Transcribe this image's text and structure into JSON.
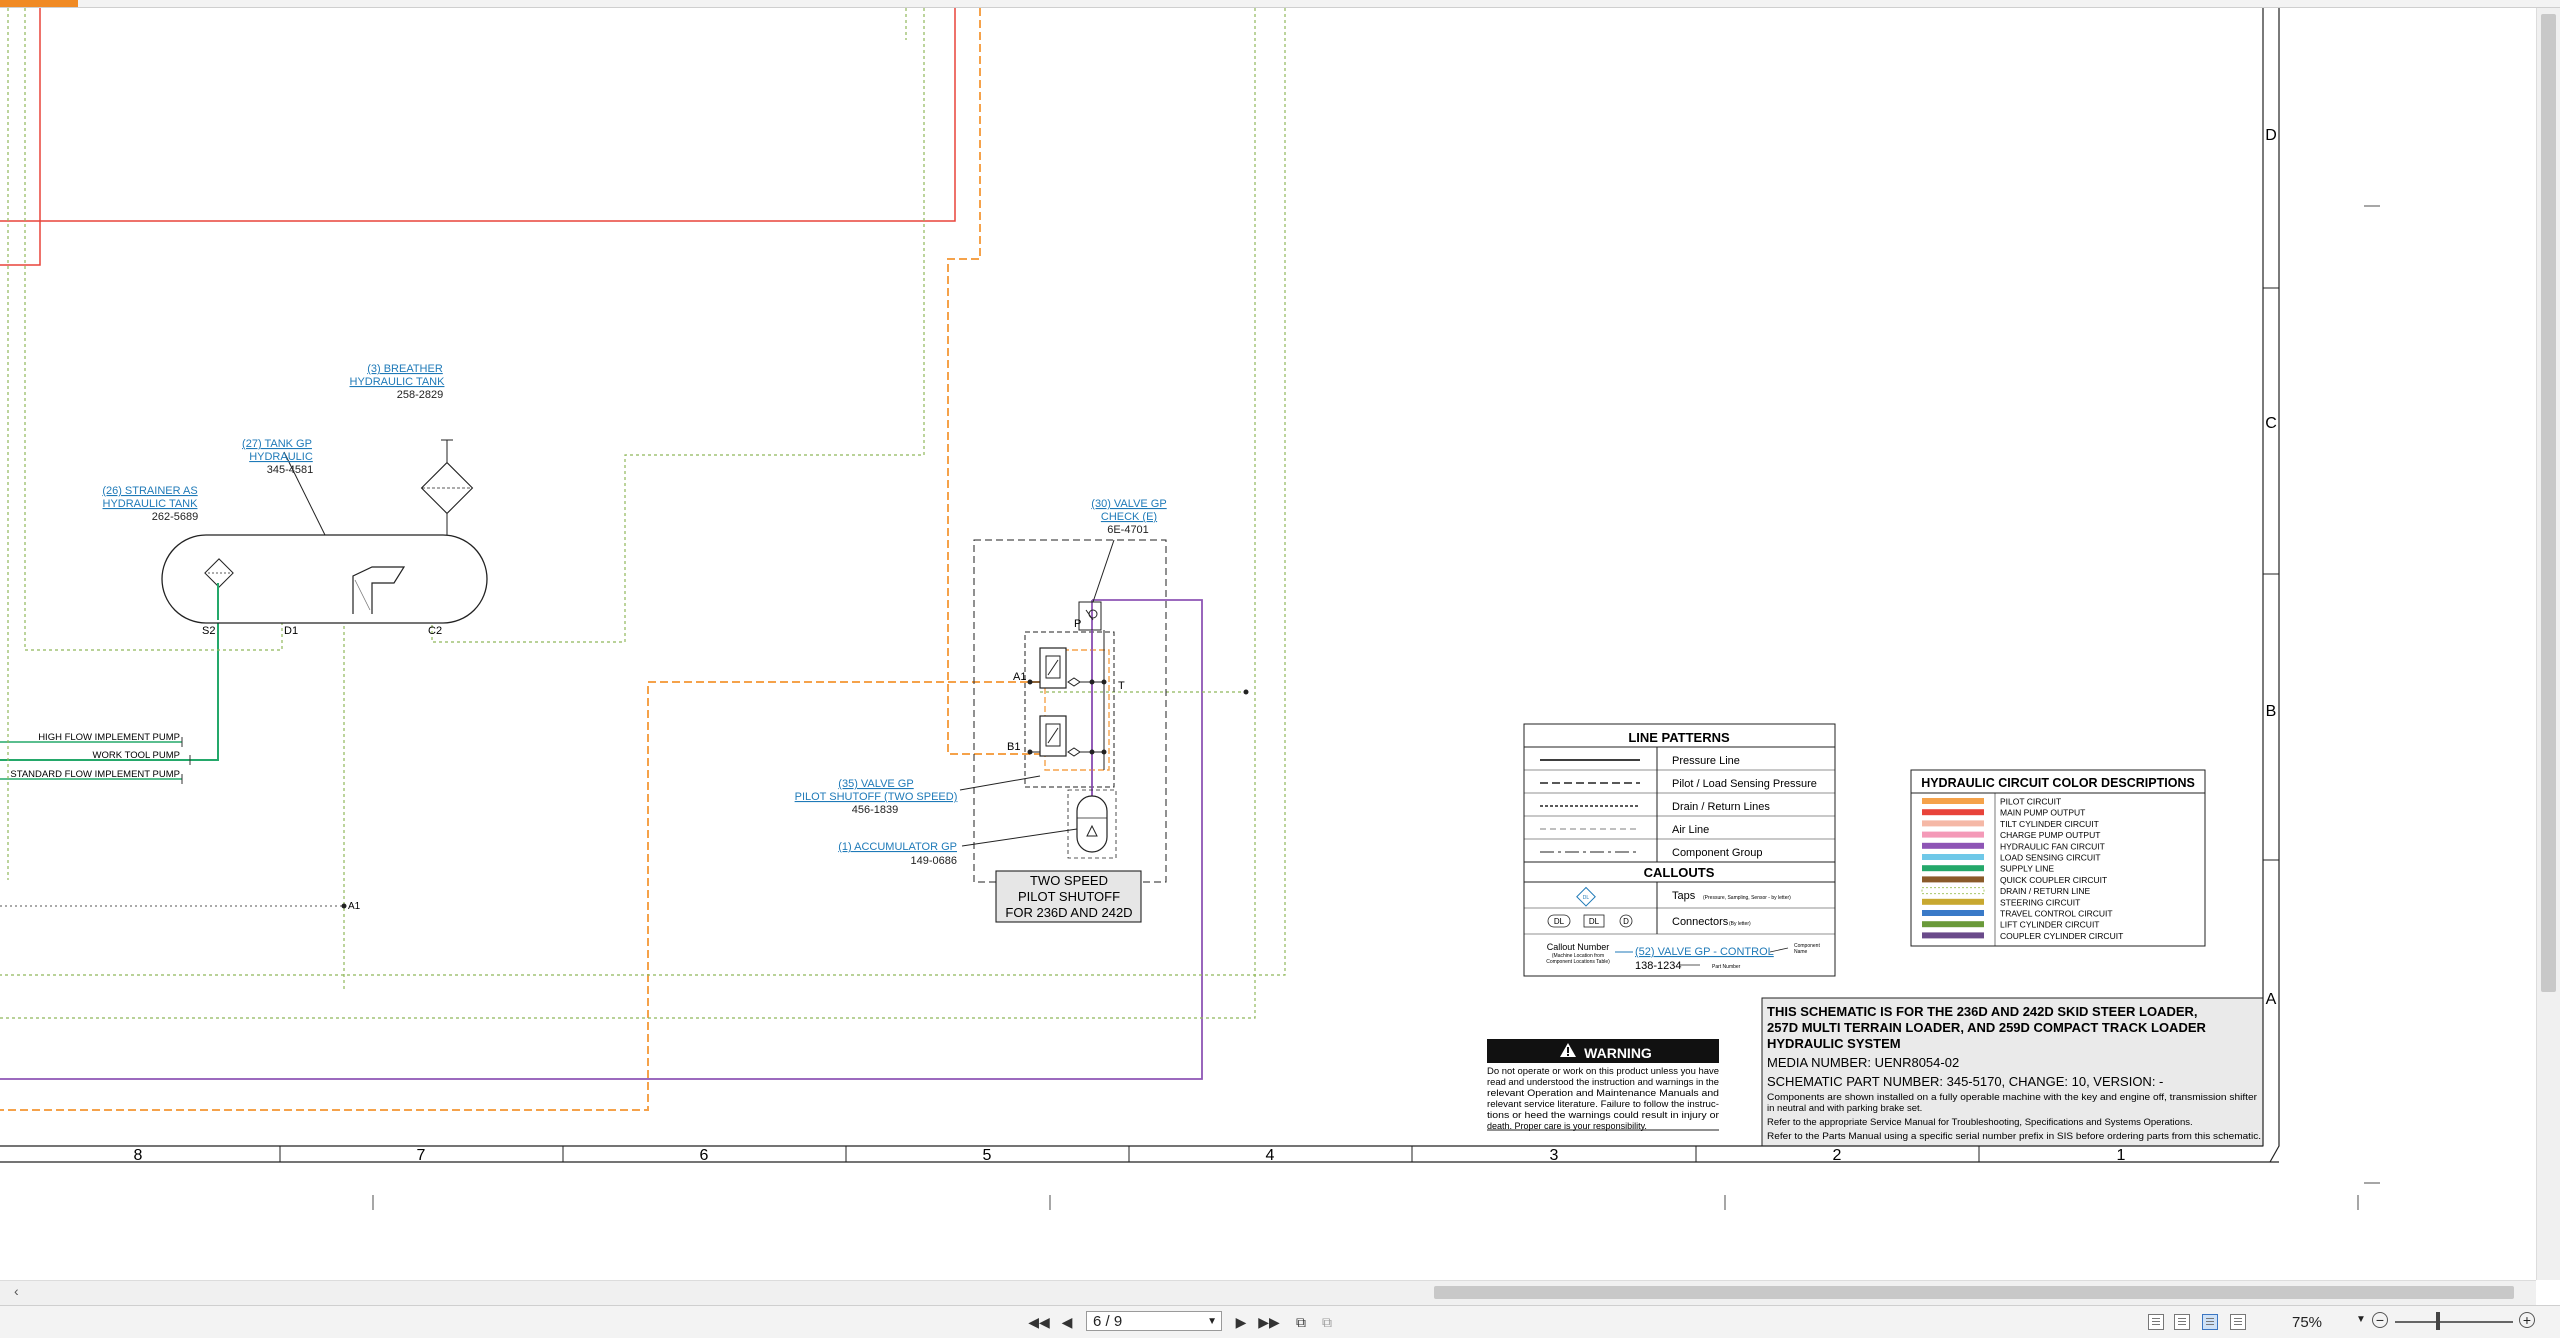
{
  "schematic": {
    "border_letters": [
      "D",
      "C",
      "B",
      "A"
    ],
    "column_numbers": [
      "8",
      "7",
      "6",
      "5",
      "4",
      "3",
      "2",
      "1"
    ],
    "components": {
      "breather": {
        "callout": [
          "(3) BREATHER",
          "HYDRAULIC TANK"
        ],
        "part": "258-2829"
      },
      "tank": {
        "callout": [
          "(27) TANK GP",
          "HYDRAULIC"
        ],
        "part": "345-4581"
      },
      "strainer": {
        "callout": [
          "(26) STRAINER AS",
          "HYDRAULIC TANK"
        ],
        "part": "262-5689"
      },
      "check_valve": {
        "callout": [
          "(30) VALVE GP",
          "CHECK (E)"
        ],
        "part": "6E-4701"
      },
      "pilot_valve": {
        "callout": [
          "(35) VALVE GP",
          "PILOT SHUTOFF (TWO SPEED)"
        ],
        "part": "456-1839"
      },
      "accumulator": {
        "callout": "(1) ACCUMULATOR GP",
        "part": "149-0686"
      }
    },
    "port_labels": {
      "s2": "S2",
      "d1": "D1",
      "c2": "C2",
      "a1": "A1",
      "b1": "B1",
      "p": "P",
      "t": "T",
      "a1_conn": "A1"
    },
    "pump_lines": [
      "HIGH FLOW IMPLEMENT PUMP",
      "WORK TOOL PUMP",
      "STANDARD FLOW IMPLEMENT PUMP"
    ],
    "two_speed_box": [
      "TWO SPEED",
      "PILOT SHUTOFF",
      "FOR 236D AND 242D"
    ],
    "line_patterns": {
      "title": "LINE PATTERNS",
      "items": [
        "Pressure Line",
        "Pilot / Load Sensing Pressure",
        "Drain / Return Lines",
        "Air Line",
        "Component Group"
      ],
      "callouts_title": "CALLOUTS",
      "taps": "Taps",
      "taps_note": "(Pressure, Sampling, Sensor - by letter)",
      "connectors": "Connectors",
      "connectors_note": "(By letter)",
      "conn_dl": "DL",
      "conn_d": "D",
      "tap_symbol": "DL",
      "callout_number": "Callout Number",
      "callout_note": [
        "(Machine Location from",
        "Component Locations Table)"
      ],
      "example_callout": "(52) VALVE GP - CONTROL",
      "example_part": "138-1234",
      "component_name": [
        "Component",
        "Name"
      ],
      "part_number": "Part Number"
    },
    "color_descriptions": {
      "title": "HYDRAULIC CIRCUIT COLOR DESCRIPTIONS",
      "items": [
        {
          "label": "PILOT CIRCUIT",
          "color": "#f5a24a"
        },
        {
          "label": "MAIN PUMP OUTPUT",
          "color": "#e8433a"
        },
        {
          "label": "TILT CYLINDER CIRCUIT",
          "color": "#f5b8a6"
        },
        {
          "label": "CHARGE PUMP OUTPUT",
          "color": "#f49ab8"
        },
        {
          "label": "HYDRAULIC FAN CIRCUIT",
          "color": "#8e55b5"
        },
        {
          "label": "LOAD SENSING CIRCUIT",
          "color": "#6fc8e8"
        },
        {
          "label": "SUPPLY LINE",
          "color": "#24a86a"
        },
        {
          "label": "QUICK COUPLER CIRCUIT",
          "color": "#8a5a2a"
        },
        {
          "label": "DRAIN / RETURN LINE",
          "color": "#a8c86a"
        },
        {
          "label": "STEERING CIRCUIT",
          "color": "#c8a830"
        },
        {
          "label": "TRAVEL CONTROL CIRCUIT",
          "color": "#3a7ac8"
        },
        {
          "label": "LIFT CYLINDER CIRCUIT",
          "color": "#6a9a3a"
        },
        {
          "label": "COUPLER CYLINDER CIRCUIT",
          "color": "#6a4a8a"
        }
      ]
    },
    "warning": {
      "title": "WARNING",
      "text": [
        "Do not operate or work on this product unless you have",
        "read and understood the instruction and warnings in the",
        "relevant Operation and Maintenance Manuals and",
        "relevant service literature. Failure to follow the instruc-",
        "tions or heed the warnings could result in injury or",
        "death. Proper care is your responsibility."
      ]
    },
    "title_block": {
      "heading": [
        "THIS SCHEMATIC IS FOR THE 236D AND 242D SKID STEER LOADER,",
        "257D MULTI TERRAIN LOADER, AND 259D COMPACT TRACK LOADER",
        "HYDRAULIC SYSTEM"
      ],
      "media": "MEDIA NUMBER: UENR8054-02",
      "part_number": "SCHEMATIC PART NUMBER: 345-5170, CHANGE: 10, VERSION: -",
      "notes": [
        "Components are shown installed on a fully operable machine with the key and engine off, transmission shifter",
        "in neutral and with parking brake set.",
        "Refer to the appropriate Service Manual for Troubleshooting, Specifications and Systems Operations.",
        "Refer to the Parts Manual using a specific serial number prefix in SIS before ordering parts from this schematic."
      ]
    }
  },
  "status_bar": {
    "page_indicator": "6 / 9",
    "zoom": "75%"
  }
}
